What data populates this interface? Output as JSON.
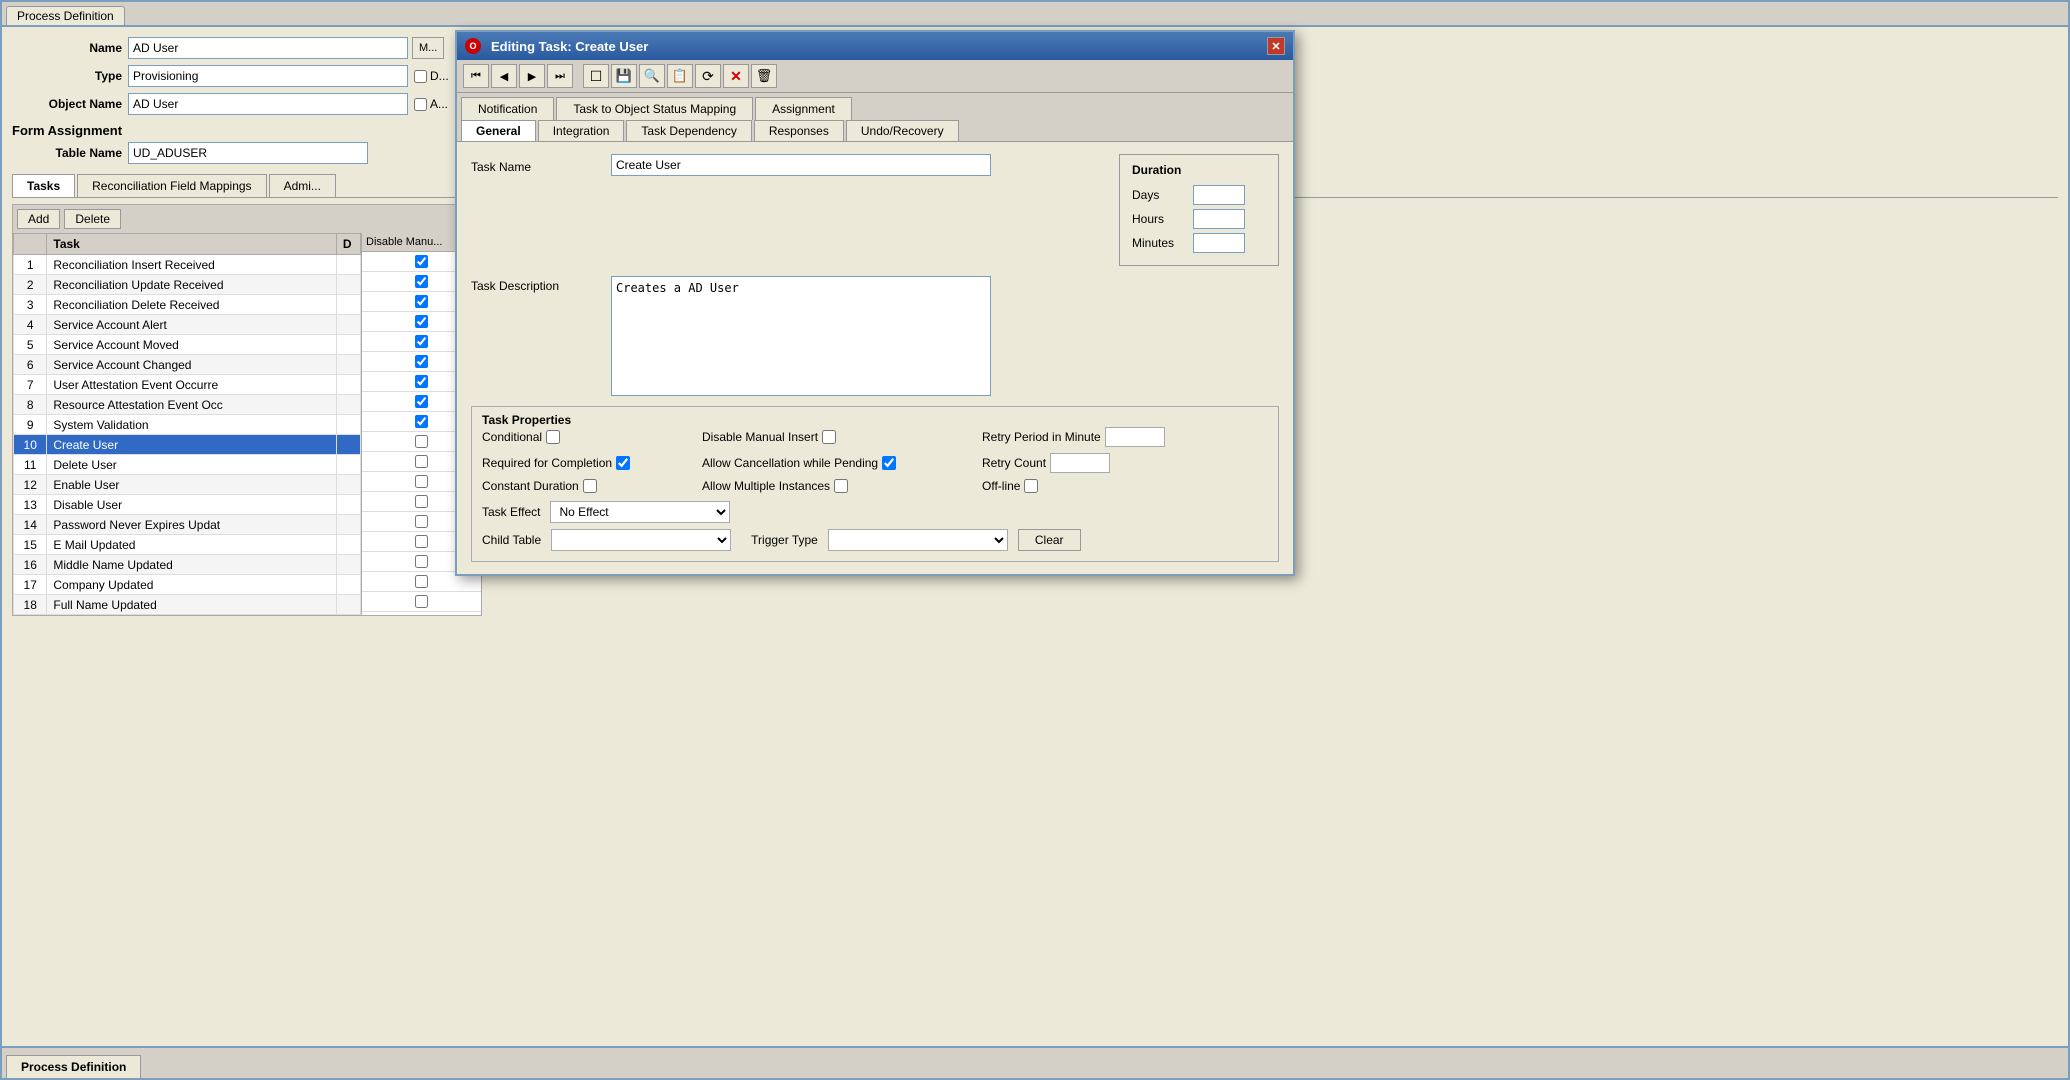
{
  "app": {
    "title": "Process Definition",
    "bottom_tab": "Process Definition"
  },
  "main_form": {
    "name_label": "Name",
    "name_value": "AD User",
    "type_label": "Type",
    "type_value": "Provisioning",
    "object_name_label": "Object Name",
    "object_name_value": "AD User",
    "form_assignment_label": "Form Assignment",
    "table_name_label": "Table Name",
    "table_name_value": "UD_ADUSER"
  },
  "lower_tabs": [
    {
      "label": "Tasks",
      "active": true
    },
    {
      "label": "Reconciliation Field Mappings"
    },
    {
      "label": "Admi..."
    }
  ],
  "tasks_table": {
    "add_btn": "Add",
    "delete_btn": "Delete",
    "columns": [
      "",
      "Task",
      "D"
    ],
    "col_disable_manual": "Disable Manu...",
    "rows": [
      {
        "num": 1,
        "task": "Reconciliation Insert Received",
        "d": ""
      },
      {
        "num": 2,
        "task": "Reconciliation Update Received",
        "d": ""
      },
      {
        "num": 3,
        "task": "Reconciliation Delete Received",
        "d": ""
      },
      {
        "num": 4,
        "task": "Service Account Alert",
        "d": ""
      },
      {
        "num": 5,
        "task": "Service Account Moved",
        "d": ""
      },
      {
        "num": 6,
        "task": "Service Account Changed",
        "d": ""
      },
      {
        "num": 7,
        "task": "User Attestation Event Occurre",
        "d": ""
      },
      {
        "num": 8,
        "task": "Resource Attestation Event Occ",
        "d": ""
      },
      {
        "num": 9,
        "task": "System Validation",
        "d": ""
      },
      {
        "num": 10,
        "task": "Create User",
        "d": "",
        "selected": true
      },
      {
        "num": 11,
        "task": "Delete User",
        "d": ""
      },
      {
        "num": 12,
        "task": "Enable User",
        "d": ""
      },
      {
        "num": 13,
        "task": "Disable User",
        "d": ""
      },
      {
        "num": 14,
        "task": "Password Never Expires Updat",
        "d": ""
      },
      {
        "num": 15,
        "task": "E Mail Updated",
        "d": ""
      },
      {
        "num": 16,
        "task": "Middle Name Updated",
        "d": ""
      },
      {
        "num": 17,
        "task": "Company Updated",
        "d": ""
      },
      {
        "num": 18,
        "task": "Full Name Updated",
        "d": ""
      }
    ]
  },
  "modal": {
    "title": "Editing Task: Create User",
    "close_btn": "✕",
    "toolbar_buttons": [
      {
        "name": "first-btn",
        "icon": "⏮",
        "label": "First"
      },
      {
        "name": "prev-btn",
        "icon": "◀",
        "label": "Previous"
      },
      {
        "name": "next-btn",
        "icon": "▶",
        "label": "Next"
      },
      {
        "name": "last-btn",
        "icon": "⏭",
        "label": "Last"
      },
      {
        "name": "new-btn",
        "icon": "📄",
        "label": "New"
      },
      {
        "name": "save-btn",
        "icon": "💾",
        "label": "Save"
      },
      {
        "name": "find-btn",
        "icon": "🔍",
        "label": "Find"
      },
      {
        "name": "copy-btn",
        "icon": "📋",
        "label": "Copy"
      },
      {
        "name": "refresh-btn",
        "icon": "↺",
        "label": "Refresh"
      },
      {
        "name": "delete-btn",
        "icon": "✕",
        "label": "Delete",
        "red": true
      },
      {
        "name": "trash-btn",
        "icon": "🗑",
        "label": "Trash"
      }
    ],
    "outer_tabs": [
      {
        "label": "Notification"
      },
      {
        "label": "Task to Object Status Mapping"
      },
      {
        "label": "Assignment"
      }
    ],
    "inner_tabs": [
      {
        "label": "General",
        "active": true
      },
      {
        "label": "Integration"
      },
      {
        "label": "Task Dependency"
      },
      {
        "label": "Responses"
      },
      {
        "label": "Undo/Recovery"
      }
    ],
    "task_name_label": "Task Name",
    "task_name_value": "Create User",
    "task_description_label": "Task Description",
    "task_description_value": "Creates a AD User",
    "duration": {
      "title": "Duration",
      "days_label": "Days",
      "hours_label": "Hours",
      "minutes_label": "Minutes",
      "days_value": "",
      "hours_value": "",
      "minutes_value": ""
    },
    "task_properties": {
      "title": "Task Properties",
      "conditional_label": "Conditional",
      "disable_manual_insert_label": "Disable Manual Insert",
      "retry_period_label": "Retry Period in Minute",
      "required_for_completion_label": "Required for Completion",
      "allow_cancellation_label": "Allow Cancellation while Pending",
      "retry_count_label": "Retry Count",
      "constant_duration_label": "Constant Duration",
      "allow_multiple_label": "Allow Multiple Instances",
      "offline_label": "Off-line",
      "required_for_completion_checked": true,
      "allow_cancellation_checked": true,
      "task_effect_label": "Task Effect",
      "task_effect_value": "No Effect",
      "child_table_label": "Child Table",
      "child_table_value": "",
      "trigger_type_label": "Trigger Type",
      "trigger_type_value": "",
      "clear_btn": "Clear"
    }
  }
}
